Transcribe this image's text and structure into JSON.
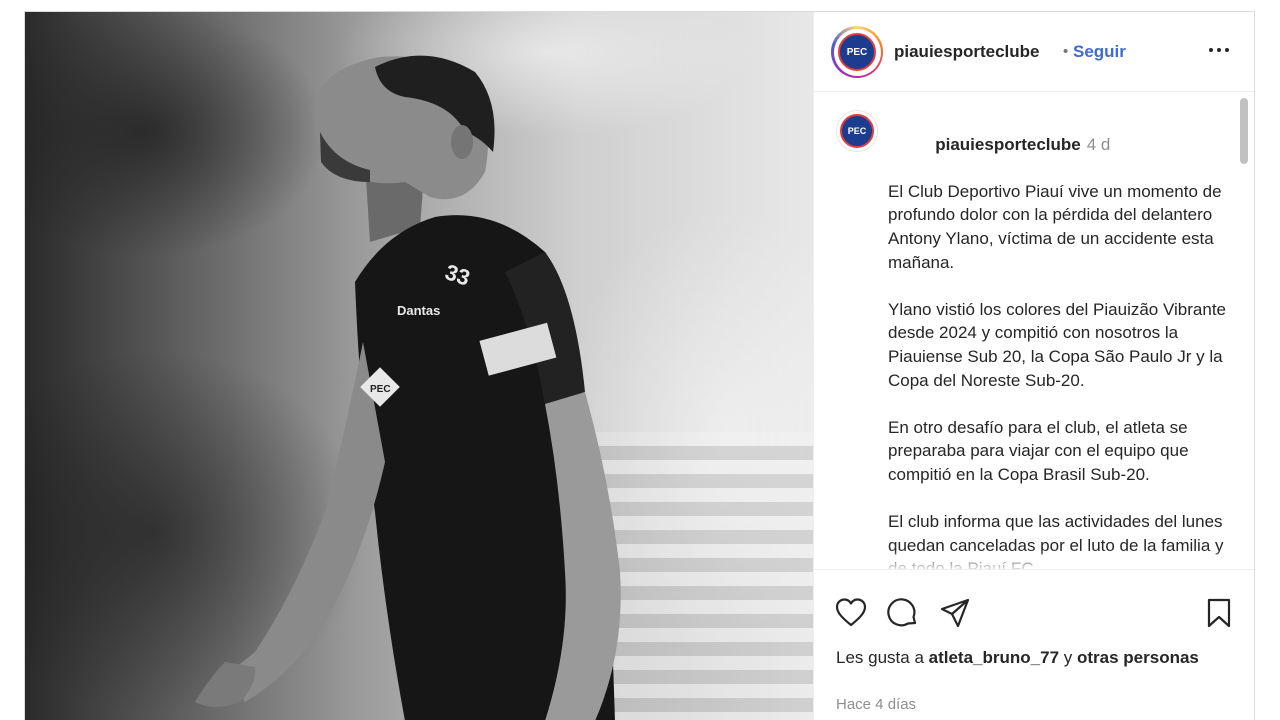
{
  "post": {
    "account": {
      "username": "piauiesporteclube",
      "follow_label": "Seguir",
      "separator": "•",
      "badge_text": "PEC"
    },
    "caption": {
      "username": "piauiesporteclube",
      "time": "4 d",
      "paragraphs": [
        "El Club Deportivo Piauí vive un momento de profundo dolor con la pérdida del delantero Antony Ylano, víctima de un accidente esta mañana.",
        "Ylano vistió los colores del Piauizão Vibrante desde 2024 y compitió con nosotros la Piauiense Sub 20, la Copa São Paulo Jr y la Copa del Noreste Sub-20.",
        "En otro desafío para el club, el atleta se preparaba para viajar con el equipo que compitió en la Copa Brasil Sub-20.",
        "El club informa que las actividades del lunes quedan canceladas por el luto de la familia y de todo la Piauí FC."
      ]
    },
    "photo": {
      "shirt_sponsor": "Dantas",
      "shirt_badge": "PEC",
      "number": "33"
    },
    "actions": {
      "icons": [
        "heart-icon",
        "comment-icon",
        "share-icon",
        "bookmark-icon"
      ],
      "likes_prefix": "Les gusta a",
      "likes_user": "atleta_bruno_77",
      "likes_conjunction": "y",
      "likes_others": "otras personas",
      "posted_ago": "Hace 4 días"
    }
  }
}
